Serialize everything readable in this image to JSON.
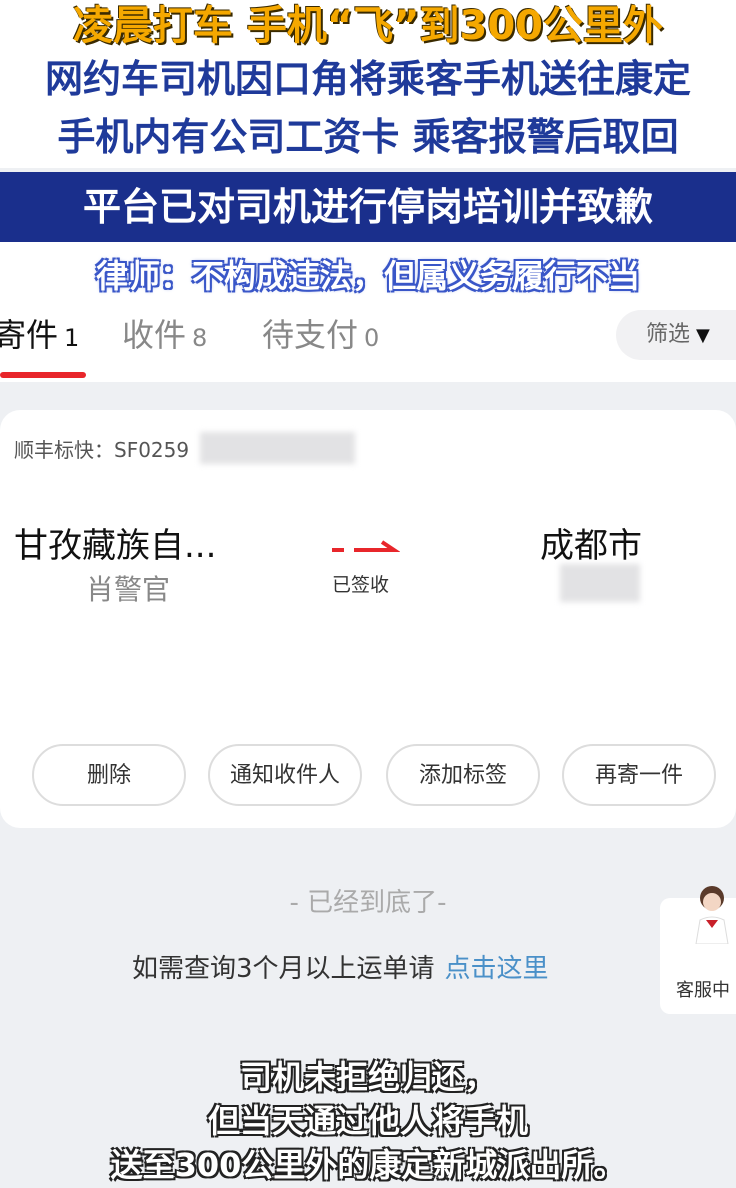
{
  "headlines": {
    "line1": "凌晨打车 手机“飞”到300公里外",
    "line2": "网约车司机因口角将乘客手机送往康定",
    "line3": "手机内有公司工资卡 乘客报警后取回",
    "line4": "平台已对司机进行停岗培训并致歉",
    "line5": "律师：不构成违法，但属义务履行不当"
  },
  "tabs": [
    {
      "label": "寄件",
      "count": "1"
    },
    {
      "label": "收件",
      "count": "8"
    },
    {
      "label": "待支付",
      "count": "0"
    }
  ],
  "filter": {
    "label": "筛选",
    "icon": "triangle-down-icon"
  },
  "shipment": {
    "waybill_label": "顺丰标快：SF0259",
    "from_city": "甘孜藏族自...",
    "from_name": "肖警官",
    "status": "已签收",
    "to_city": "成都市",
    "arrow_color": "#e8262b"
  },
  "actions": {
    "delete": "删除",
    "notify": "通知收件人",
    "add_tag": "添加标签",
    "send_again": "再寄一件"
  },
  "footer": {
    "end_note": "- 已经到底了-",
    "query_text": "如需查询3个月以上运单请",
    "query_link": "点击这里",
    "customer_service": "客服中"
  },
  "subtitles": {
    "line1": "司机未拒绝归还，",
    "line2": "但当天通过他人将手机",
    "line3": "送至300公里外的康定新城派出所。"
  }
}
